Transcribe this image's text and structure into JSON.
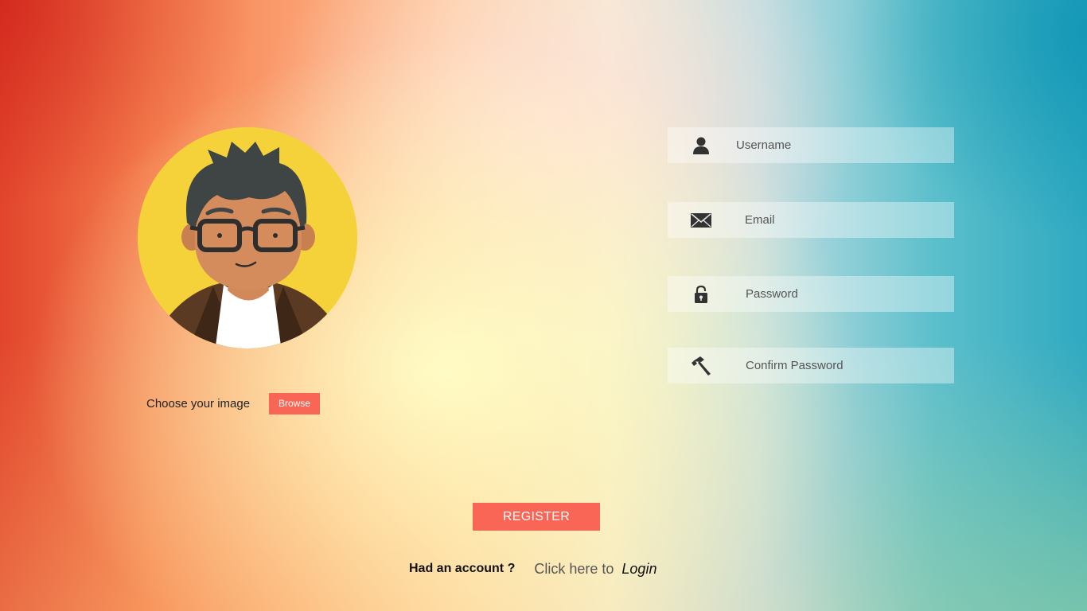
{
  "avatar": {
    "icon": "cartoon-man-with-glasses",
    "background_color": "#f6d23a"
  },
  "image_picker": {
    "label": "Choose your image",
    "browse_label": "Browse"
  },
  "form": {
    "username": {
      "placeholder": "Username",
      "icon": "user-icon"
    },
    "email": {
      "placeholder": "Email",
      "icon": "envelope-icon"
    },
    "password": {
      "placeholder": "Password",
      "icon": "lock-icon"
    },
    "confirm_password": {
      "placeholder": "Confirm Password",
      "icon": "hammer-icon"
    }
  },
  "register": {
    "label": "REGISTER"
  },
  "login_prompt": {
    "question": "Had an account ?",
    "click_here": "Click here to",
    "link": "Login"
  },
  "colors": {
    "accent": "#fa6655"
  }
}
